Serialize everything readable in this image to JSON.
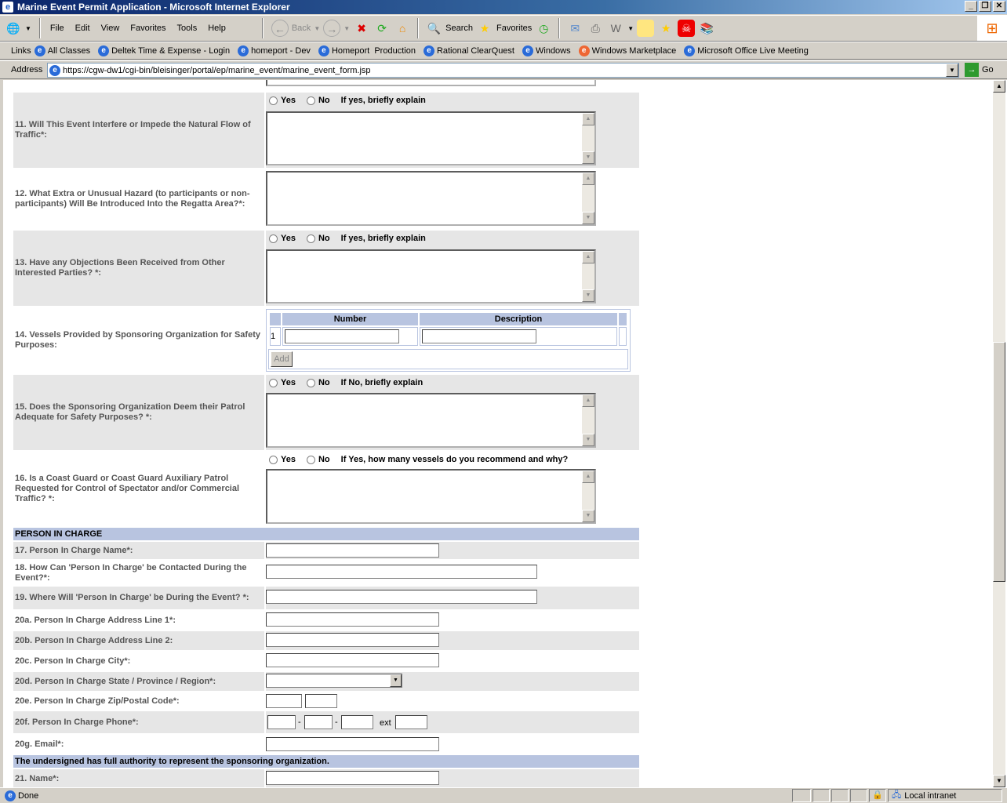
{
  "window": {
    "title": "Marine Event Permit Application - Microsoft Internet Explorer"
  },
  "menu": [
    "File",
    "Edit",
    "View",
    "Favorites",
    "Tools",
    "Help"
  ],
  "toolbar": {
    "back": "Back",
    "search": "Search",
    "favorites": "Favorites"
  },
  "links": {
    "label": "Links",
    "items": [
      "All Classes",
      "Deltek Time & Expense - Login",
      "homeport - Dev",
      "Homeport  Production",
      "Rational ClearQuest",
      "Windows",
      "Windows Marketplace",
      "Microsoft Office Live Meeting"
    ]
  },
  "address": {
    "label": "Address",
    "url": "https://cgw-dw1/cgi-bin/bleisinger/portal/ep/marine_event/marine_event_form.jsp",
    "go": "Go"
  },
  "radio": {
    "yes": "Yes",
    "no": "No"
  },
  "q11": {
    "label": "11. Will This Event Interfere or Impede the Natural Flow of Traffic*:",
    "prompt": "If yes, briefly explain"
  },
  "q12": {
    "label": "12. What Extra or Unusual Hazard (to participants or non-participants) Will Be Introduced Into the Regatta Area?*:"
  },
  "q13": {
    "label": "13. Have any Objections Been Received from Other Interested Parties? *:",
    "prompt": "If yes, briefly explain"
  },
  "q14": {
    "label": "14. Vessels Provided by Sponsoring Organization for Safety Purposes:",
    "col_number": "Number",
    "col_description": "Description",
    "row_index": "1",
    "add": "Add"
  },
  "q15": {
    "label": "15. Does the Sponsoring Organization Deem their Patrol Adequate for Safety Purposes? *:",
    "prompt": "If No, briefly explain"
  },
  "q16": {
    "label": "16. Is a Coast Guard or Coast Guard Auxiliary Patrol Requested for Control of Spectator and/or Commercial Traffic? *:",
    "prompt": "If Yes, how many vessels do you recommend and why?"
  },
  "section_pic": "PERSON IN CHARGE",
  "q17": "17. Person In Charge Name*:",
  "q18": "18. How Can 'Person In Charge' be Contacted During the Event?*:",
  "q19": "19. Where Will 'Person In Charge' be During the Event? *:",
  "q20a": "20a. Person In Charge Address Line 1*:",
  "q20b": "20b. Person In Charge Address Line 2:",
  "q20c": "20c. Person In Charge City*:",
  "q20d": "20d. Person In Charge State / Province / Region*:",
  "q20e": "20e. Person In Charge Zip/Postal Code*:",
  "q20f": {
    "label": "20f. Person In Charge Phone*:",
    "dash": "-",
    "ext": "ext"
  },
  "q20g": "20g. Email*:",
  "section_auth": "The undersigned has full authority to represent the sponsoring organization.",
  "q21": "21. Name*:",
  "status": {
    "text": "Done",
    "zone": "Local intranet"
  }
}
